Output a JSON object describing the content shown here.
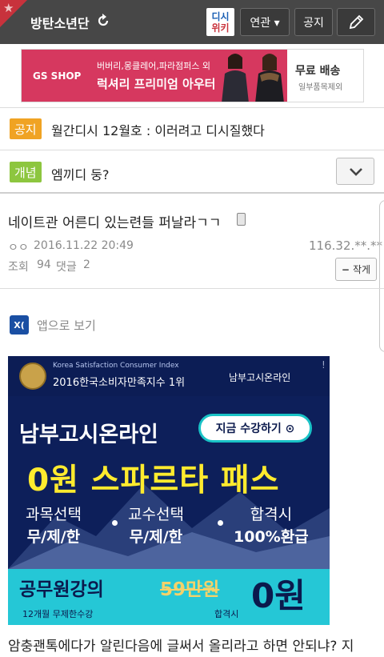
{
  "header": {
    "gallery_title": "방탄소년단",
    "wiki_line1": "디시",
    "wiki_line2": "위키",
    "related_label": "연관 ▾",
    "notice_label": "공지"
  },
  "banner_ad": {
    "logo": "GS SHOP",
    "sub": "버버리,몽클레어,파라점퍼스 외",
    "main": "럭셔리 프리미엄 아우터",
    "right_top": "무료 배송",
    "right_bottom": "일부품목제외"
  },
  "notices": [
    {
      "tag": "공지",
      "tag_color": "#f0a323",
      "text": "월간디시 12월호 : 이러려고 디시질했다"
    },
    {
      "tag": "개념",
      "tag_color": "#8dc63f",
      "text": "엠끼디 둥?"
    }
  ],
  "post": {
    "title": "네이트관 어른디 있는련들 퍼날라ㄱㄱ",
    "author": "ㅇㅇ",
    "date": "2016.11.22 20:49",
    "ip": "116.32.**.**",
    "views_label": "조회",
    "views": "94",
    "comments_label": "댓글",
    "comments": "2",
    "smaller_label": "작게"
  },
  "app_view": {
    "icon_text": "X(",
    "label": "앱으로 보기"
  },
  "ad2": {
    "ksi": "Korea Satisfaction Consumer Index",
    "index_text": "2016한국소비자만족지수 1위",
    "brand": "남부고시온라인",
    "bang": "!",
    "name": "남부고시온라인",
    "cta": "지금 수강하기 ⊙",
    "sparta": "0원 스파르타 패스",
    "feat1_a": "과목선택",
    "feat1_b": "무/제/한",
    "feat2_a": "교수선택",
    "feat2_b": "무/제/한",
    "feat3_a": "합격시",
    "feat3_b": "100%환급",
    "bottom1": "공무원강의",
    "price_old": "59만원",
    "price_new": "0원",
    "bottom_note1": "12개월 무제한수강",
    "bottom_note2": "합격시"
  },
  "body_text": "암충괜톡에다가 알린다음에 글써서 올리라고 하면 안되냐? 지"
}
